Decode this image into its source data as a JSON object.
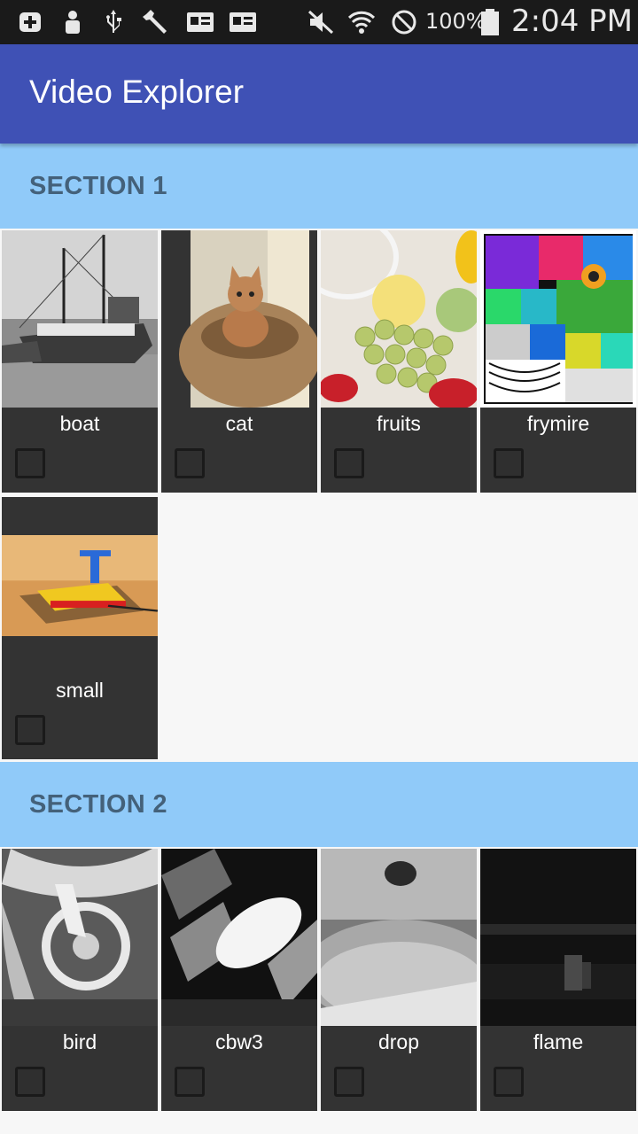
{
  "status_bar": {
    "battery_percent": "100%",
    "time": "2:04 PM",
    "icons": [
      "plus-icon",
      "person-icon",
      "usb-icon",
      "wrench-icon",
      "card-icon",
      "card-icon",
      "mute-icon",
      "wifi-icon",
      "no-sim-icon",
      "battery-icon"
    ]
  },
  "app_bar": {
    "title": "Video Explorer",
    "color": "#3f51b5"
  },
  "section_color": "#90caf9",
  "sections": [
    {
      "title": "SECTION 1",
      "items": [
        {
          "label": "boat",
          "checked": false
        },
        {
          "label": "cat",
          "checked": false
        },
        {
          "label": "fruits",
          "checked": false
        },
        {
          "label": "frymire",
          "checked": false
        },
        {
          "label": "small",
          "checked": false
        }
      ]
    },
    {
      "title": "SECTION 2",
      "items": [
        {
          "label": "bird",
          "checked": false
        },
        {
          "label": "cbw3",
          "checked": false
        },
        {
          "label": "drop",
          "checked": false
        },
        {
          "label": "flame",
          "checked": false
        }
      ]
    }
  ]
}
